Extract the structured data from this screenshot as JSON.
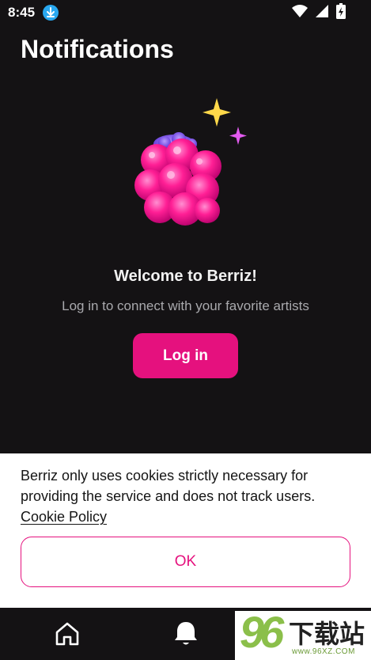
{
  "status_bar": {
    "time": "8:45",
    "icons": [
      "download-icon",
      "wifi-icon",
      "signal-icon",
      "battery-icon"
    ]
  },
  "header": {
    "title": "Notifications"
  },
  "hero": {
    "illustration": "raspberry-with-sparkles"
  },
  "empty_state": {
    "heading": "Welcome to Berriz!",
    "subtitle": "Log in to connect with your favorite artists",
    "login_label": "Log in"
  },
  "cookie_banner": {
    "text": "Berriz only uses cookies strictly necessary for providing the service and does not track users.",
    "link_label": "Cookie Policy",
    "ok_label": "OK"
  },
  "bottom_nav": {
    "items": [
      {
        "icon": "home-icon",
        "active": false
      },
      {
        "icon": "bell-icon",
        "active": true
      }
    ]
  },
  "watermark": {
    "number": "96",
    "cn_text": "下载站",
    "url": "www.96XZ.COM"
  },
  "colors": {
    "background": "#141214",
    "accent": "#e5117e",
    "sheet": "#ffffff"
  }
}
